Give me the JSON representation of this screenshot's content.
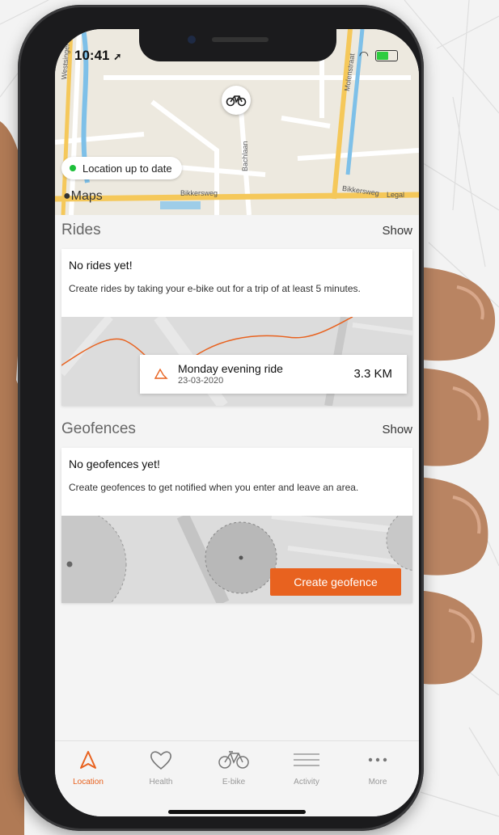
{
  "status_bar": {
    "time": "10:41"
  },
  "map": {
    "location_status": "Location up to date",
    "maps_brand": "Maps",
    "street_labels": [
      "Westsingel",
      "Molenstraat",
      "Bachlaan",
      "Bikkersweg",
      "Bikkersweg",
      "Legal"
    ]
  },
  "rides": {
    "section_title": "Rides",
    "show_label": "Show",
    "empty_title": "No rides yet!",
    "empty_description": "Create rides by taking your e-bike out for a trip of at least 5 minutes.",
    "sample_ride": {
      "name": "Monday evening ride",
      "date": "23-03-2020",
      "distance": "3.3 KM"
    }
  },
  "geofences": {
    "section_title": "Geofences",
    "show_label": "Show",
    "empty_title": "No geofences yet!",
    "empty_description": "Create geofences to get notified when you enter and leave an area.",
    "create_button": "Create geofence"
  },
  "tabs": [
    {
      "label": "Location",
      "icon": "location-arrow-icon",
      "active": true
    },
    {
      "label": "Health",
      "icon": "heart-icon",
      "active": false
    },
    {
      "label": "E-bike",
      "icon": "bicycle-icon",
      "active": false
    },
    {
      "label": "Activity",
      "icon": "menu-lines-icon",
      "active": false
    },
    {
      "label": "More",
      "icon": "more-dots-icon",
      "active": false
    }
  ],
  "colors": {
    "accent": "#e8621f",
    "status_green": "#1dbf3a"
  }
}
